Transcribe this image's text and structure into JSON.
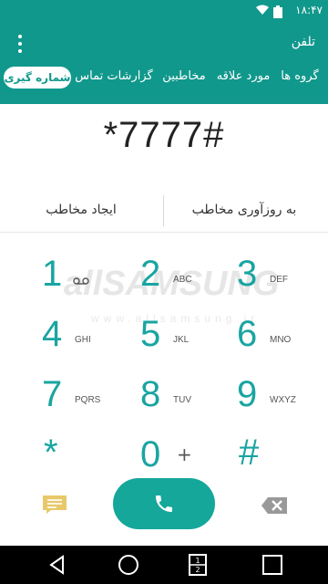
{
  "status_bar": {
    "time": "۱۸:۴۷",
    "wifi_icon": "wifi-icon",
    "battery_icon": "battery-icon"
  },
  "app": {
    "title": "تلفن"
  },
  "tabs": [
    {
      "label": "گروه ها",
      "active": false
    },
    {
      "label": "مورد علاقه",
      "active": false
    },
    {
      "label": "مخاطبین",
      "active": false
    },
    {
      "label": "گزارشات تماس",
      "active": false
    },
    {
      "label": "شماره گیری",
      "active": true
    }
  ],
  "dialer": {
    "number": "*7777#",
    "update_contact": "به روزآوری مخاطب",
    "create_contact": "ایجاد مخاطب"
  },
  "watermark": {
    "big": "allSAMSUNG",
    "small": "www.allsamsung.ir"
  },
  "keys": [
    {
      "digit": "1",
      "letters": ""
    },
    {
      "digit": "2",
      "letters": "ABC"
    },
    {
      "digit": "3",
      "letters": "DEF"
    },
    {
      "digit": "4",
      "letters": "GHI"
    },
    {
      "digit": "5",
      "letters": "JKL"
    },
    {
      "digit": "6",
      "letters": "MNO"
    },
    {
      "digit": "7",
      "letters": "PQRS"
    },
    {
      "digit": "8",
      "letters": "TUV"
    },
    {
      "digit": "9",
      "letters": "WXYZ"
    },
    {
      "digit": "*",
      "letters": ""
    },
    {
      "digit": "0",
      "letters": "+"
    },
    {
      "digit": "#",
      "letters": ""
    }
  ],
  "colors": {
    "primary": "#11988c",
    "accent": "#19a5a1",
    "call": "#14a79a",
    "delete": "#999999",
    "message": "#e8c86a"
  },
  "icons": {
    "message": "message-icon",
    "call": "phone-icon",
    "delete": "backspace-icon",
    "voicemail": "voicemail-icon"
  },
  "nav": {
    "back": "back-icon",
    "home": "home-icon",
    "dual": "dual-window-icon",
    "recents": "recents-icon"
  }
}
